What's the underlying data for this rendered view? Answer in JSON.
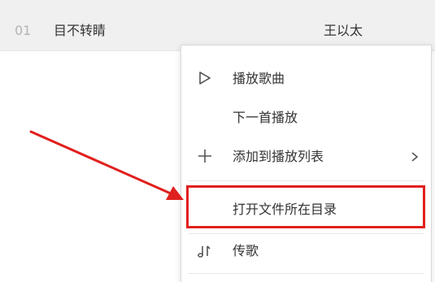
{
  "song_row": {
    "index": "01",
    "title": "目不转睛",
    "artist": "王以太"
  },
  "context_menu": {
    "items": [
      {
        "label": "播放歌曲",
        "icon": "play-icon"
      },
      {
        "label": "下一首播放",
        "icon": ""
      },
      {
        "label": "添加到播放列表",
        "icon": "plus-icon",
        "has_submenu": true
      },
      {
        "label": "打开文件所在目录",
        "icon": ""
      },
      {
        "label": "传歌",
        "icon": "music-transfer-icon"
      }
    ]
  },
  "annotation": {
    "highlight_color": "#e0201e",
    "highlighted_item": "打开文件所在目录"
  }
}
